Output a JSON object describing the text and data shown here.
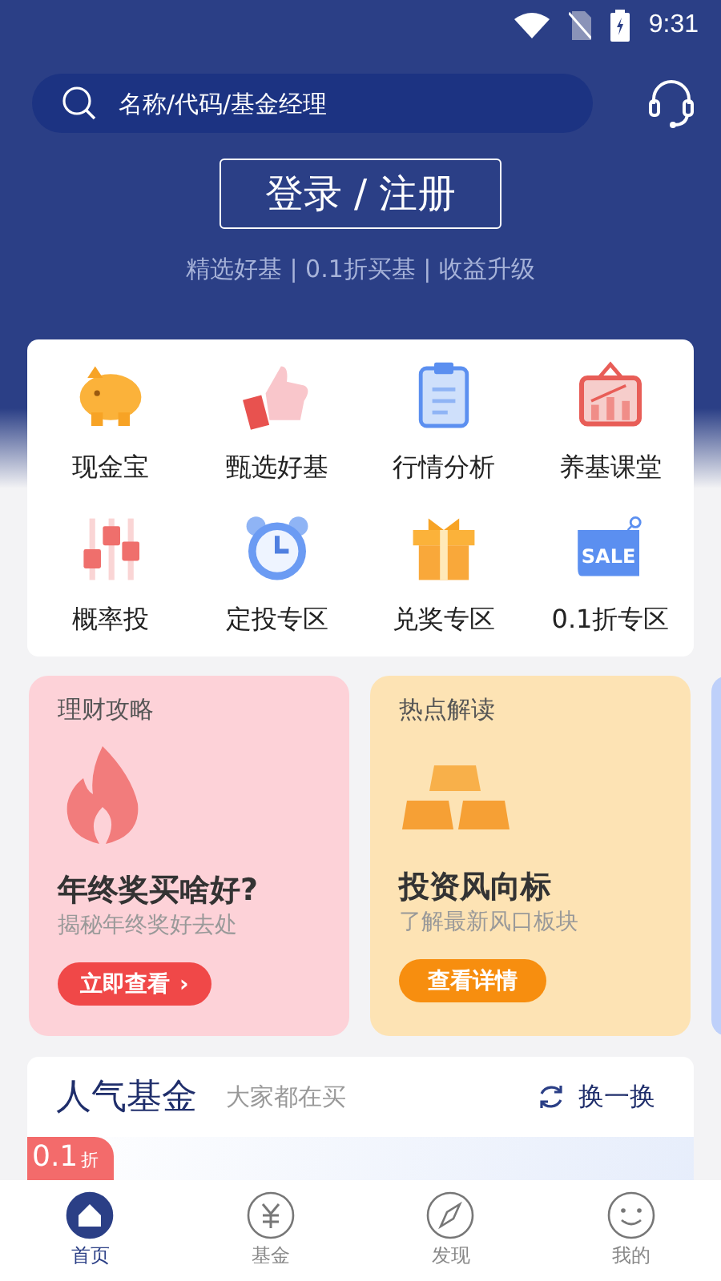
{
  "status_bar": {
    "time": "9:31"
  },
  "search": {
    "placeholder": "名称/代码/基金经理"
  },
  "login_button": "登录 / 注册",
  "tagline": "精选好基 | 0.1折买基 | 收益升级",
  "shortcuts": [
    {
      "label": "现金宝",
      "kind": "pig"
    },
    {
      "label": "甄选好基",
      "kind": "thumb"
    },
    {
      "label": "行情分析",
      "kind": "clipboard"
    },
    {
      "label": "养基课堂",
      "kind": "board"
    },
    {
      "label": "概率投",
      "kind": "sliders"
    },
    {
      "label": "定投专区",
      "kind": "clock"
    },
    {
      "label": "兑奖专区",
      "kind": "gift"
    },
    {
      "label": "0.1折专区",
      "kind": "sale",
      "icon_text": "SALE"
    }
  ],
  "promo_cards": [
    {
      "kind": "fire",
      "category": "理财攻略",
      "title": "年终奖买啥好?",
      "subtitle": "揭秘年终奖好去处",
      "button": "立即查看",
      "button_arrow": "›"
    },
    {
      "kind": "gold",
      "category": "热点解读",
      "title": "投资风向标",
      "subtitle": "了解最新风口板块",
      "button": "查看详情"
    }
  ],
  "popular": {
    "title": "人气基金",
    "subtitle": "大家都在买",
    "refresh": "换一换",
    "badge_number": "0.1",
    "badge_unit": "折"
  },
  "bottom_nav": [
    {
      "label": "首页",
      "kind": "home",
      "selected": true
    },
    {
      "label": "基金",
      "kind": "fund",
      "selected": false
    },
    {
      "label": "发现",
      "kind": "compass",
      "selected": false
    },
    {
      "label": "我的",
      "kind": "smile",
      "selected": false
    }
  ]
}
